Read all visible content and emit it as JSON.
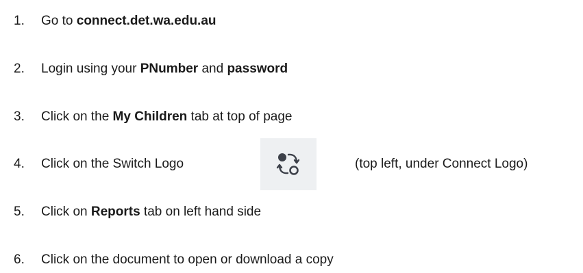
{
  "steps": [
    {
      "num": "1.",
      "parts": [
        "Go to ",
        "connect.det.wa.edu.au"
      ]
    },
    {
      "num": "2.",
      "parts": [
        "Login using your ",
        "PNumber",
        " and ",
        "password"
      ]
    },
    {
      "num": "3.",
      "parts": [
        "Click on the ",
        "My Children",
        " tab at top of page"
      ]
    },
    {
      "num": "4.",
      "parts": [
        "Click on the Switch Logo"
      ],
      "trailing": "(top left, under Connect Logo)"
    },
    {
      "num": "5.",
      "parts": [
        "Click on ",
        "Reports",
        " tab on left hand side"
      ]
    },
    {
      "num": "6.",
      "parts": [
        "Click on the document to open or download a copy"
      ]
    }
  ],
  "icons": {
    "switch_logo": "switch-icon"
  },
  "colors": {
    "text": "#1a1a1a",
    "icon_box_bg": "#eef0f2",
    "icon_stroke": "#3c4049"
  }
}
